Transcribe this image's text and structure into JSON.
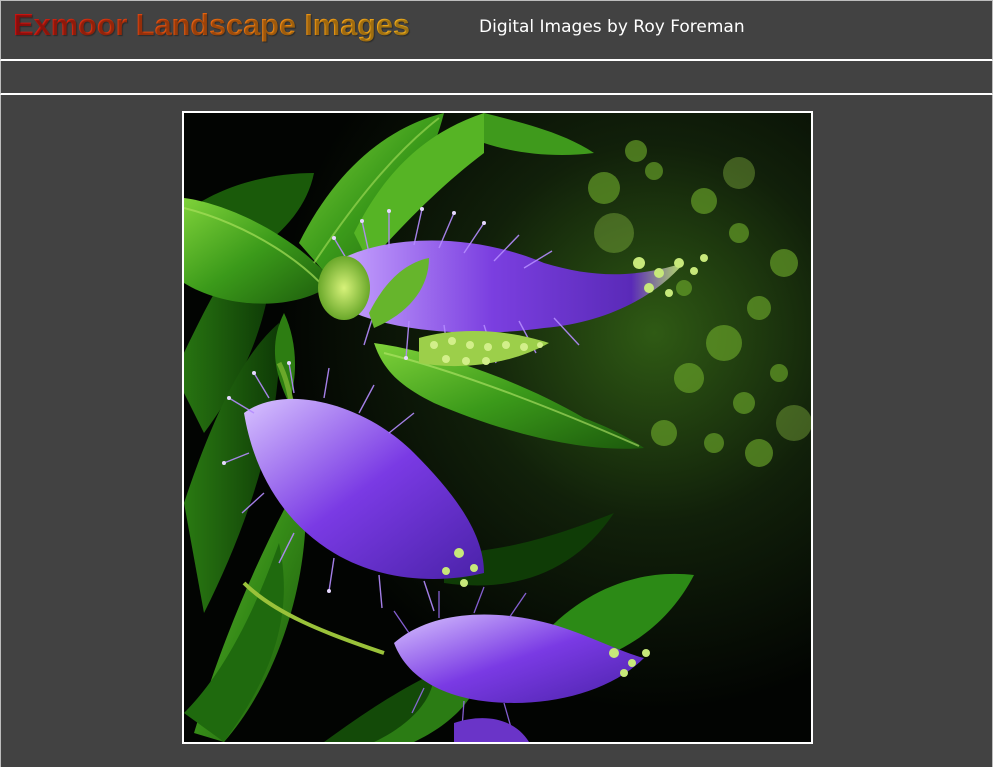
{
  "header": {
    "title": "Exmoor Landscape Images",
    "subtitle": "Digital Images by Roy Foreman"
  },
  "colors": {
    "background": "#424242",
    "title_gradient_start": "#d01212",
    "title_gradient_end": "#f4b21c",
    "subtitle": "#ffffff",
    "frame_border": "#ffffff",
    "flower_purple": "#7b3fe0",
    "leaf_green": "#3f9a1c"
  }
}
